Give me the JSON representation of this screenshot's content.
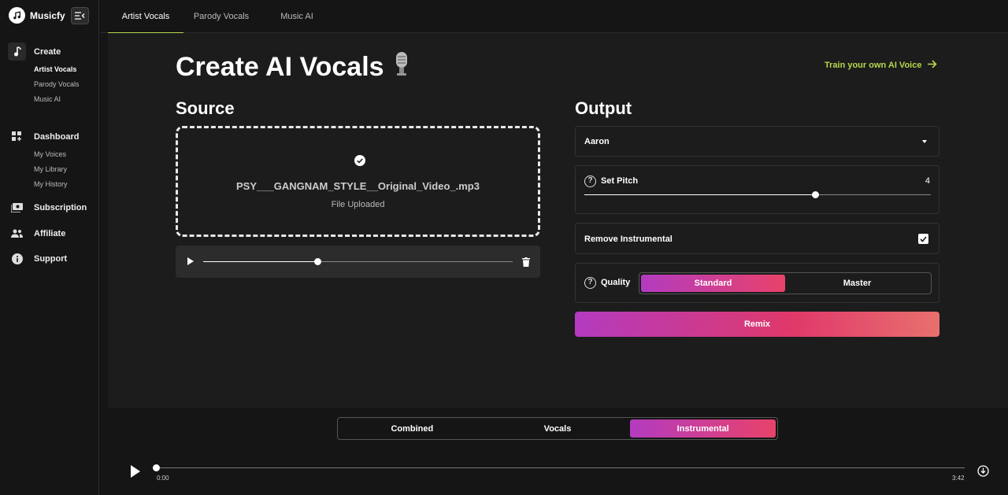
{
  "brand": {
    "name": "Musicfy"
  },
  "sidebar": {
    "create": {
      "label": "Create",
      "items": [
        "Artist Vocals",
        "Parody Vocals",
        "Music AI"
      ]
    },
    "dashboard": {
      "label": "Dashboard",
      "items": [
        "My Voices",
        "My Library",
        "My History"
      ]
    },
    "subscription": "Subscription",
    "affiliate": "Affiliate",
    "support": "Support"
  },
  "tabs": [
    "Artist Vocals",
    "Parody Vocals",
    "Music AI"
  ],
  "page": {
    "title": "Create AI Vocals",
    "train_link": "Train your own AI Voice"
  },
  "source": {
    "title": "Source",
    "file_name": "PSY___GANGNAM_STYLE__Original_Video_.mp3",
    "status": "File Uploaded",
    "progress": 0.37
  },
  "output": {
    "title": "Output",
    "voice": "Aaron",
    "pitch_label": "Set Pitch",
    "pitch_value": "4",
    "pitch_fraction": 0.665,
    "remove_instrumental_label": "Remove Instrumental",
    "remove_instrumental_checked": true,
    "quality_label": "Quality",
    "quality_options": [
      "Standard",
      "Master"
    ],
    "quality_selected": "Standard",
    "remix_label": "Remix"
  },
  "player": {
    "stems": [
      "Combined",
      "Vocals",
      "Instrumental"
    ],
    "stem_selected": "Instrumental",
    "current_time": "0:00",
    "duration": "3:42"
  },
  "colors": {
    "accent_green": "#b6d84a",
    "gradient_start": "#b33bc0",
    "gradient_end": "#e8426a"
  }
}
